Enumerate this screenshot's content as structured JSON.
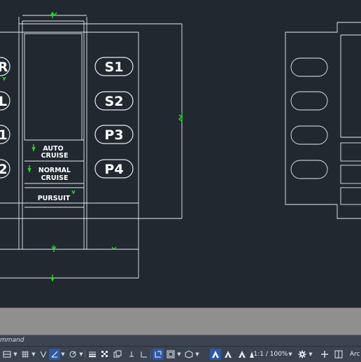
{
  "canvas": {
    "panel_labels": [
      "S1",
      "S2",
      "P3",
      "P4"
    ],
    "left_cut_labels": [
      "R",
      "L",
      "1",
      "2"
    ],
    "mode_labels": [
      [
        "AUTO",
        "CRUISE"
      ],
      [
        "NORMAL",
        "CRUISE"
      ],
      [
        "PURSUIT"
      ]
    ]
  },
  "command_line": {
    "prompt": "mmand"
  },
  "status_bar": {
    "scale": "1:1 / 100%",
    "workspace_partial": "Arc",
    "icons": [
      "model-space-icon",
      "grid-icon",
      "snap-icon",
      "ortho-icon",
      "polar-tracking-icon",
      "isodraft-icon",
      "object-snap-tracking-icon",
      "object-snap-icon",
      "lineweight-icon",
      "transparency-icon",
      "selection-cycling-icon",
      "3d-osnap-icon",
      "dynamic-ucs-icon",
      "selection-filter-icon",
      "gizmo-icon",
      "annotation-visibility-icon",
      "auto-scale-icon",
      "annotation-scale-icon",
      "workspace-switch-icon",
      "annotation-monitor-icon",
      "units-icon"
    ]
  },
  "colors": {
    "background": "#212830",
    "line": "#ffffff",
    "dimension": "#00ff00",
    "accent": "#2c5aa8",
    "redline": "#c0272d"
  }
}
